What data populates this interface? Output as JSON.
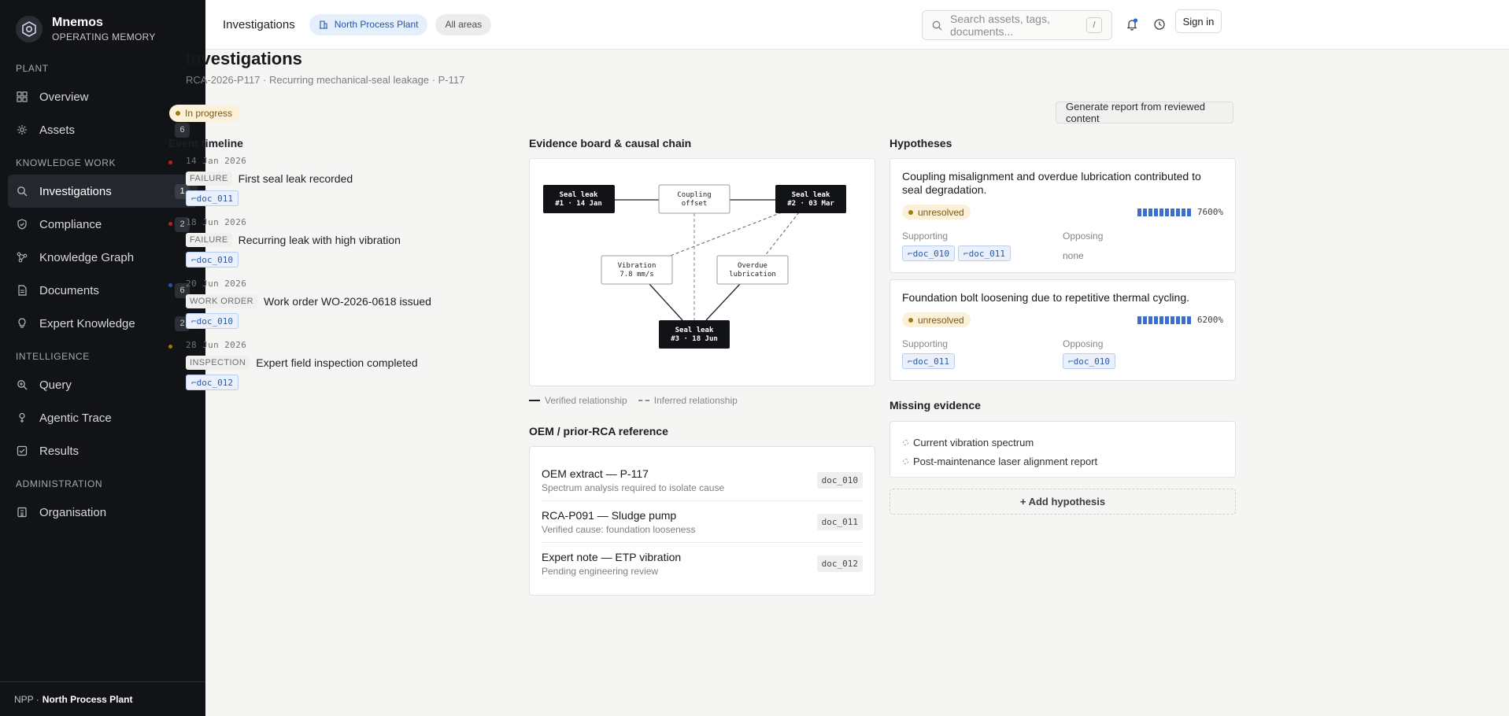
{
  "brand": {
    "name": "Mnemos",
    "subtitle": "OPERATING MEMORY"
  },
  "sidebar": {
    "sections": [
      {
        "label": "PLANT",
        "items": [
          {
            "label": "Overview",
            "icon": "grid-icon",
            "count": ""
          },
          {
            "label": "Assets",
            "icon": "gear-icon",
            "count": "6"
          }
        ]
      },
      {
        "label": "KNOWLEDGE WORK",
        "items": [
          {
            "label": "Investigations",
            "icon": "search-icon",
            "count": "1",
            "active": true
          },
          {
            "label": "Compliance",
            "icon": "shield-icon",
            "count": "2"
          },
          {
            "label": "Knowledge Graph",
            "icon": "graph-icon",
            "count": ""
          },
          {
            "label": "Documents",
            "icon": "document-icon",
            "count": "6"
          },
          {
            "label": "Expert Knowledge",
            "icon": "lightbulb-icon",
            "count": "2"
          }
        ]
      },
      {
        "label": "INTELLIGENCE",
        "items": [
          {
            "label": "Query",
            "icon": "query-icon",
            "count": ""
          },
          {
            "label": "Agentic Trace",
            "icon": "trace-icon",
            "count": ""
          },
          {
            "label": "Results",
            "icon": "checkbox-icon",
            "count": ""
          }
        ]
      },
      {
        "label": "ADMINISTRATION",
        "items": [
          {
            "label": "Organisation",
            "icon": "building-icon",
            "count": ""
          }
        ]
      }
    ],
    "footer": {
      "prefix": "NPP ·",
      "plant": "North Process Plant"
    }
  },
  "topbar": {
    "crumb": "Investigations",
    "plant_pill": "North Process Plant",
    "areas_pill": "All areas",
    "search_placeholder": "Search assets, tags, documents...",
    "search_shortcut": "/",
    "signin": "Sign in"
  },
  "page": {
    "title": "Investigations",
    "subtitle": "RCA-2026-P117 · Recurring mechanical-seal leakage · P-117",
    "status": "In progress",
    "generate_button": "Generate report from reviewed content"
  },
  "timeline": {
    "title": "Event timeline",
    "events": [
      {
        "date": "14 Jan 2026",
        "type": "FAILURE",
        "title": "First seal leak recorded",
        "doc": "⌐doc_011",
        "color": "#b3261e"
      },
      {
        "date": "18 Jun 2026",
        "type": "FAILURE",
        "title": "Recurring leak with high vibration",
        "doc": "⌐doc_010",
        "color": "#b3261e"
      },
      {
        "date": "20 Jun 2026",
        "type": "WORK ORDER",
        "title": "Work order WO-2026-0618 issued",
        "doc": "⌐doc_010",
        "color": "#2456a8"
      },
      {
        "date": "28 Jun 2026",
        "type": "INSPECTION",
        "title": "Expert field inspection completed",
        "doc": "⌐doc_012",
        "color": "#a07a12"
      }
    ]
  },
  "evidence": {
    "title": "Evidence board & causal chain",
    "nodes": {
      "leak1": [
        "Seal leak",
        "#1 · 14 Jan"
      ],
      "coupling": [
        "Coupling",
        "offset"
      ],
      "leak2": [
        "Seal leak",
        "#2 · 03 Mar"
      ],
      "vibration": [
        "Vibration",
        "7.8 mm/s"
      ],
      "lubrication": [
        "Overdue",
        "lubrication"
      ],
      "leak3": [
        "Seal leak",
        "#3 · 18 Jun"
      ]
    },
    "legend": {
      "verified": "Verified relationship",
      "inferred": "Inferred relationship"
    }
  },
  "references": {
    "title": "OEM / prior-RCA reference",
    "items": [
      {
        "title": "OEM extract — P-117",
        "sub": "Spectrum analysis required to isolate cause",
        "doc": "doc_010"
      },
      {
        "title": "RCA-P091 — Sludge pump",
        "sub": "Verified cause: foundation looseness",
        "doc": "doc_011"
      },
      {
        "title": "Expert note — ETP vibration",
        "sub": "Pending engineering review",
        "doc": "doc_012"
      }
    ]
  },
  "hypotheses": {
    "title": "Hypotheses",
    "supporting_label": "Supporting",
    "opposing_label": "Opposing",
    "items": [
      {
        "title": "Coupling misalignment and overdue lubrication contributed to seal degradation.",
        "status": "unresolved",
        "confidence": "7600%",
        "supporting": [
          "⌐doc_010",
          "⌐doc_011"
        ],
        "opposing": [],
        "opposing_none": "none"
      },
      {
        "title": "Foundation bolt loosening due to repetitive thermal cycling.",
        "status": "unresolved",
        "confidence": "6200%",
        "supporting": [
          "⌐doc_011"
        ],
        "opposing": [
          "⌐doc_010"
        ],
        "opposing_none": ""
      }
    ],
    "add_button": "+ Add hypothesis"
  },
  "missing": {
    "title": "Missing evidence",
    "items": [
      "Current vibration spectrum",
      "Post-maintenance laser alignment report"
    ]
  },
  "colors": {
    "accent": "#2456a8",
    "sidebar_bg": "#111317",
    "warning_bg": "#fbf1d8",
    "bar": "#3a6fd0"
  }
}
